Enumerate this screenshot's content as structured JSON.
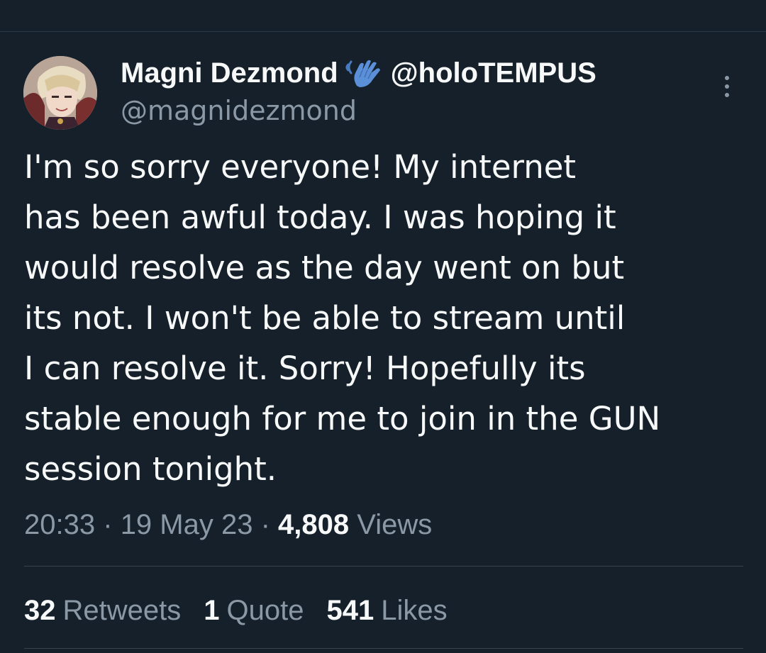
{
  "author": {
    "display_name": "Magni Dezmond",
    "affiliation_icon": "waving-hand-icon",
    "affiliation_handle": "@holoTEMPUS",
    "handle": "@magnidezmond",
    "avatar_icon": "avatar"
  },
  "tweet": {
    "text": "I'm so sorry everyone! My internet\nhas been awful today. I was hoping it\nwould resolve as the day went on but\nits not. I won't be able to stream until\nI can resolve it. Sorry! Hopefully its\nstable enough for me to join in the GUN\nsession tonight.",
    "time": "20:33",
    "date": "19 May 23",
    "separator": "·",
    "views_count": "4,808",
    "views_label": "Views"
  },
  "stats": {
    "retweets_count": "32",
    "retweets_label": "Retweets",
    "quotes_count": "1",
    "quotes_label": "Quote",
    "likes_count": "541",
    "likes_label": "Likes"
  },
  "colors": {
    "background": "#15202b",
    "primary_text": "#f7f9f9",
    "secondary_text": "#8b98a5",
    "divider": "#38444d",
    "hand_icon": "#5b8fd8"
  }
}
